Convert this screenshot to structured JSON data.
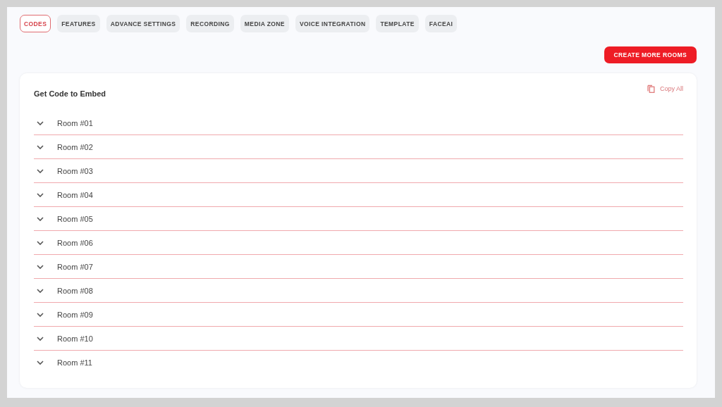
{
  "tabs": [
    {
      "label": "CODES",
      "selected": true
    },
    {
      "label": "FEATURES",
      "selected": false
    },
    {
      "label": "ADVANCE SETTINGS",
      "selected": false
    },
    {
      "label": "RECORDING",
      "selected": false
    },
    {
      "label": "MEDIA ZONE",
      "selected": false
    },
    {
      "label": "VOICE INTEGRATION",
      "selected": false
    },
    {
      "label": "TEMPLATE",
      "selected": false
    },
    {
      "label": "FACEAI",
      "selected": false
    }
  ],
  "create_button": "CREATE MORE ROOMS",
  "card": {
    "title": "Get Code to Embed",
    "copy_all": "Copy All",
    "rooms": [
      {
        "label": "Room #01",
        "expanded": false
      },
      {
        "label": "Room #02",
        "expanded": false
      },
      {
        "label": "Room #03",
        "expanded": false
      },
      {
        "label": "Room #04",
        "expanded": false
      },
      {
        "label": "Room #05",
        "expanded": false
      },
      {
        "label": "Room #06",
        "expanded": false
      },
      {
        "label": "Room #07",
        "expanded": false
      },
      {
        "label": "Room #08",
        "expanded": false
      },
      {
        "label": "Room #09",
        "expanded": false
      },
      {
        "label": "Room #10",
        "expanded": false
      },
      {
        "label": "Room #11",
        "expanded": false
      }
    ]
  }
}
